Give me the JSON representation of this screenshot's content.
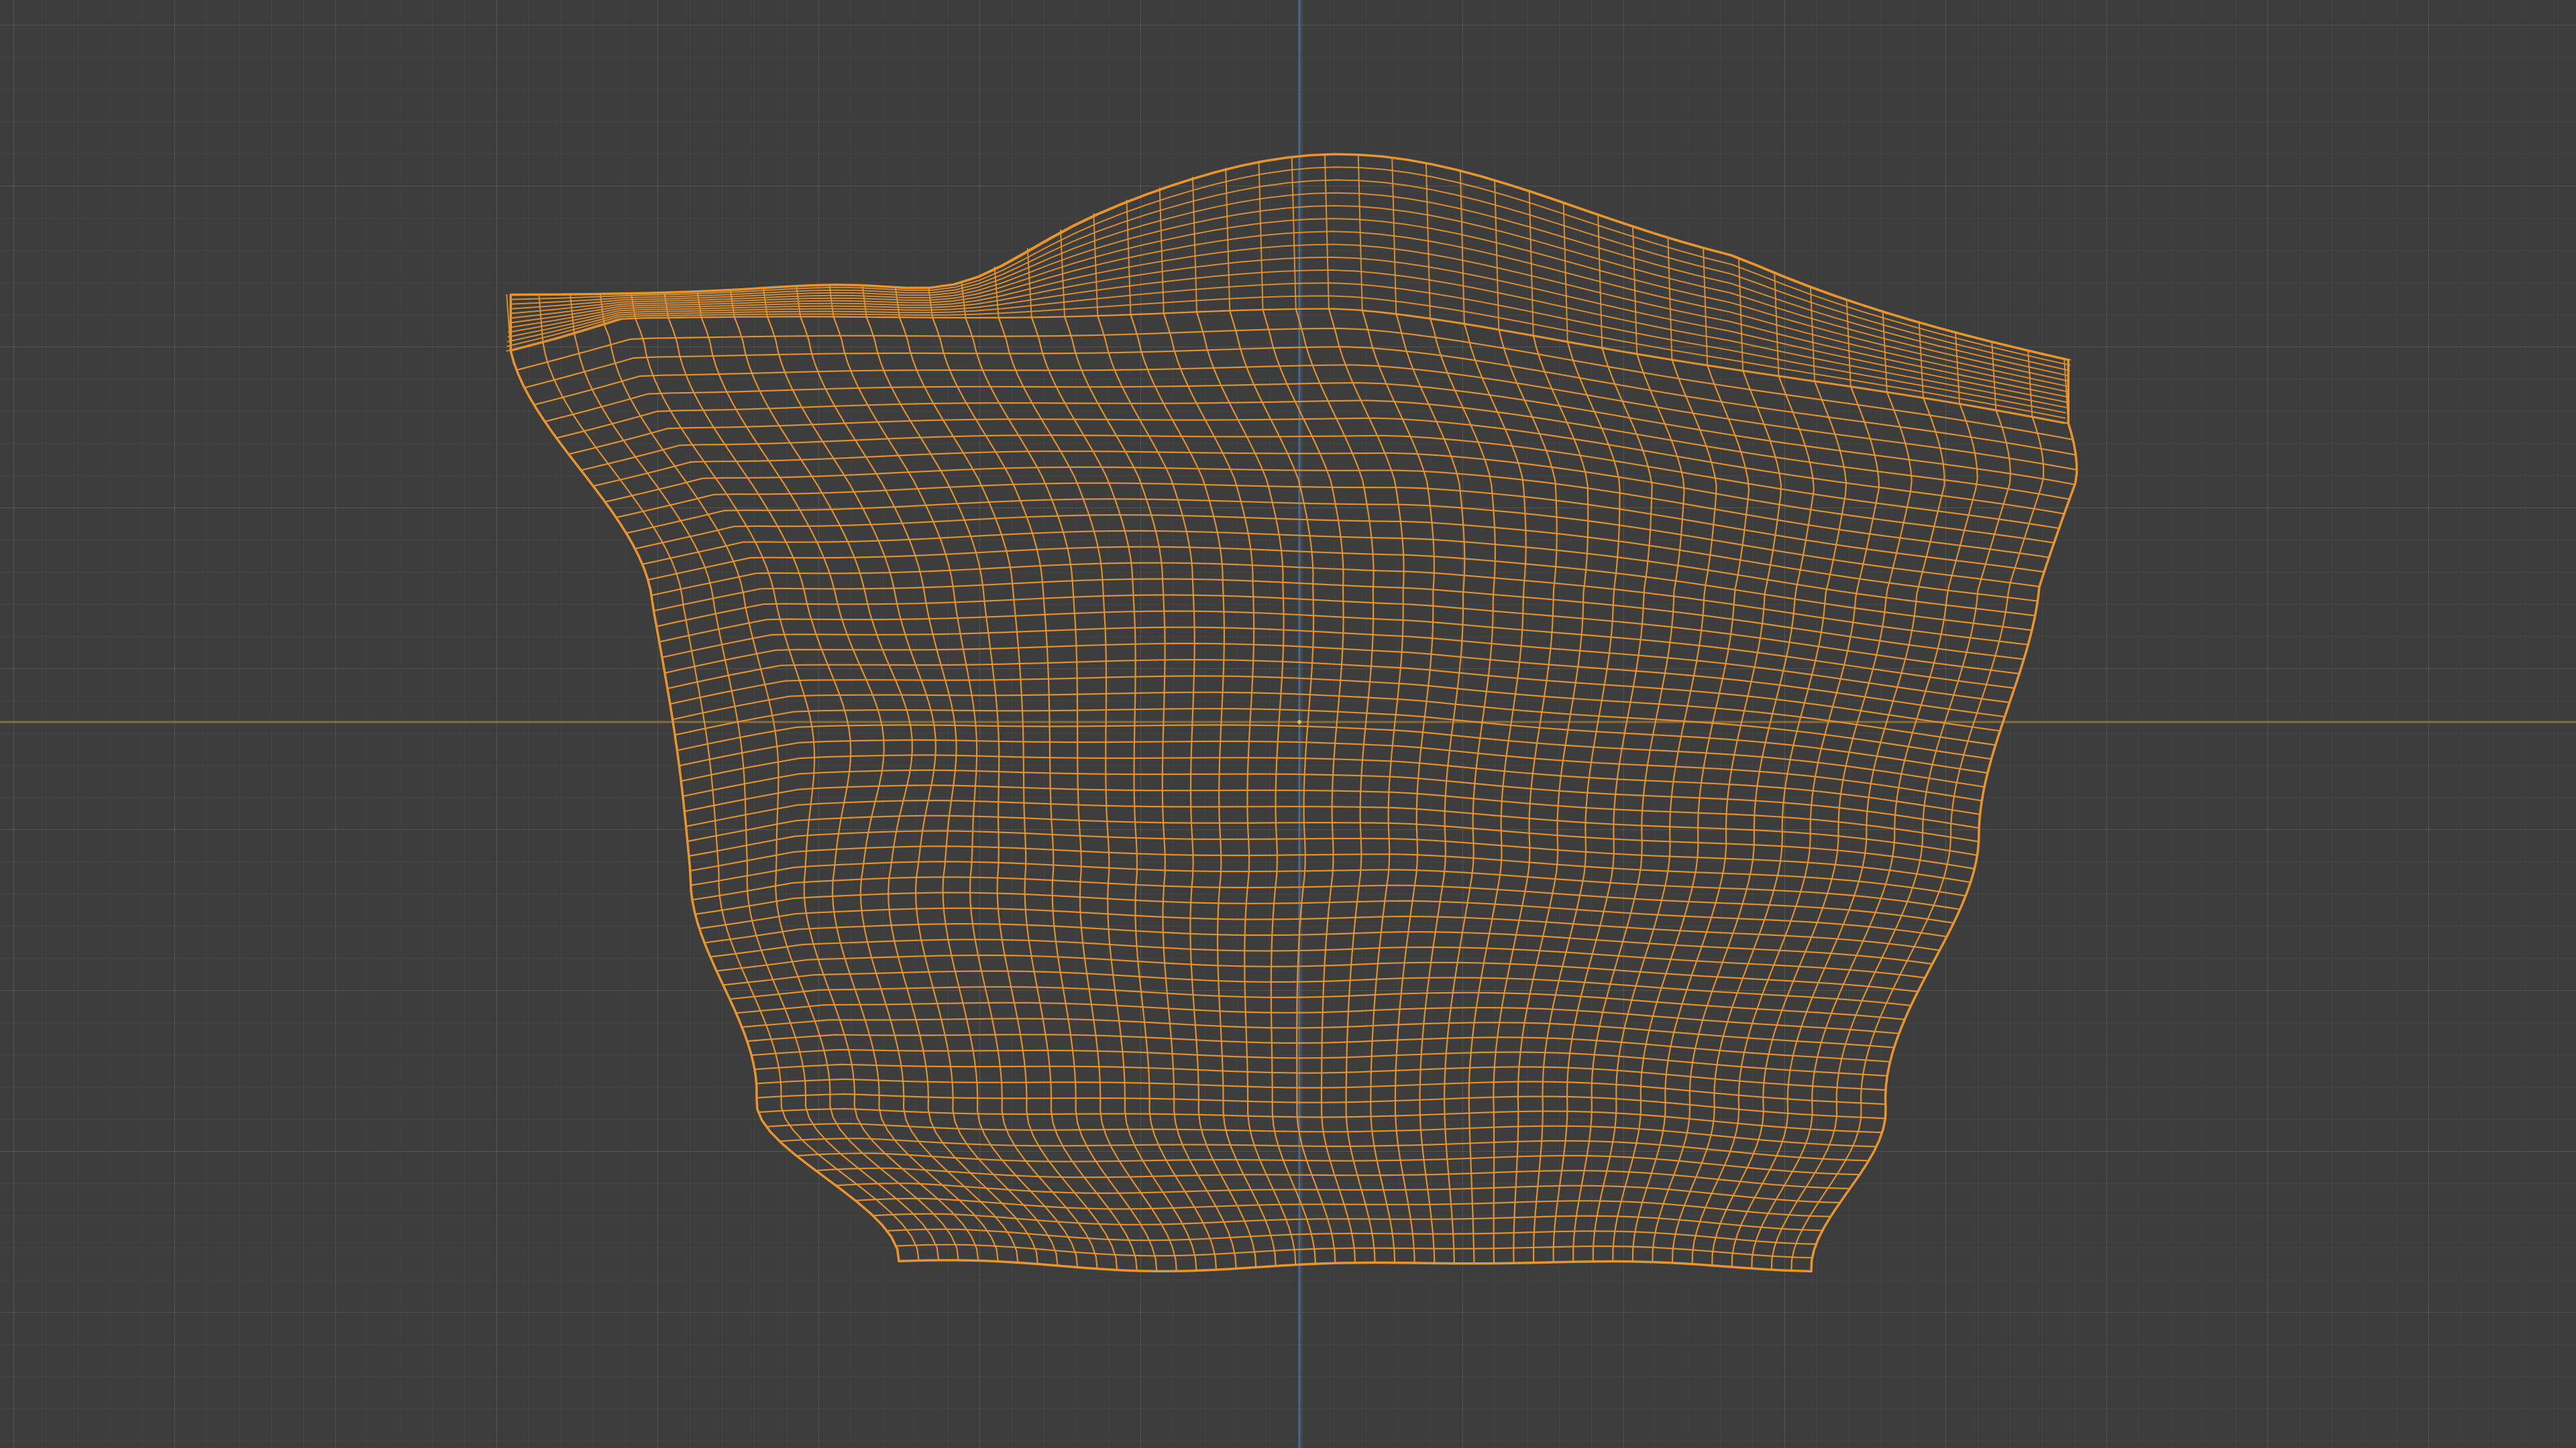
{
  "viewport": {
    "background_color": "#3d3d3d",
    "grid_color": "#4a4a4a",
    "x_axis_color": "#8a6b3a",
    "z_axis_color": "#4a6a8a",
    "object_wire_color": "#e8952e",
    "origin_color": "#d4c23a"
  },
  "object": {
    "name": "",
    "display_mode": "wireframe",
    "selected": true
  }
}
